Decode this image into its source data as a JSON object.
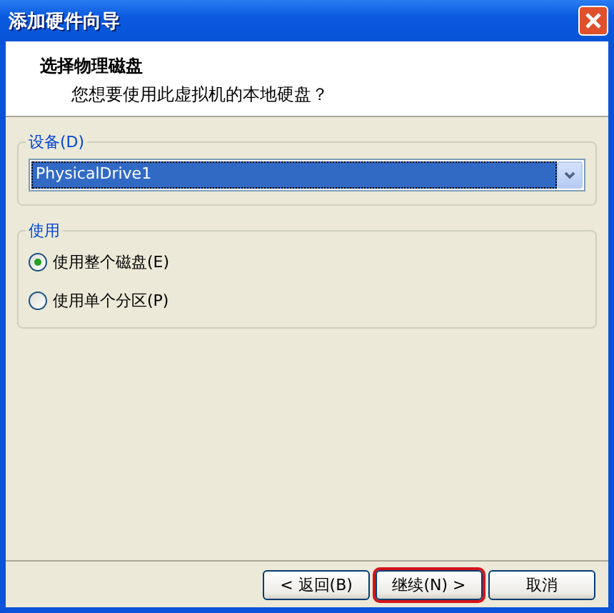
{
  "window": {
    "title": "添加硬件向导"
  },
  "header": {
    "title": "选择物理磁盘",
    "subtitle": "您想要使用此虚拟机的本地硬盘？"
  },
  "device_group": {
    "label": "设备(D)",
    "value": "PhysicalDrive1"
  },
  "usage_group": {
    "label": "使用",
    "options": [
      {
        "label": "使用整个磁盘(E)",
        "selected": true
      },
      {
        "label": "使用单个分区(P)",
        "selected": false
      }
    ]
  },
  "buttons": [
    {
      "label": "< 返回(B)",
      "highlighted": false
    },
    {
      "label": "继续(N) >",
      "highlighted": true
    },
    {
      "label": "取消",
      "highlighted": false
    }
  ]
}
